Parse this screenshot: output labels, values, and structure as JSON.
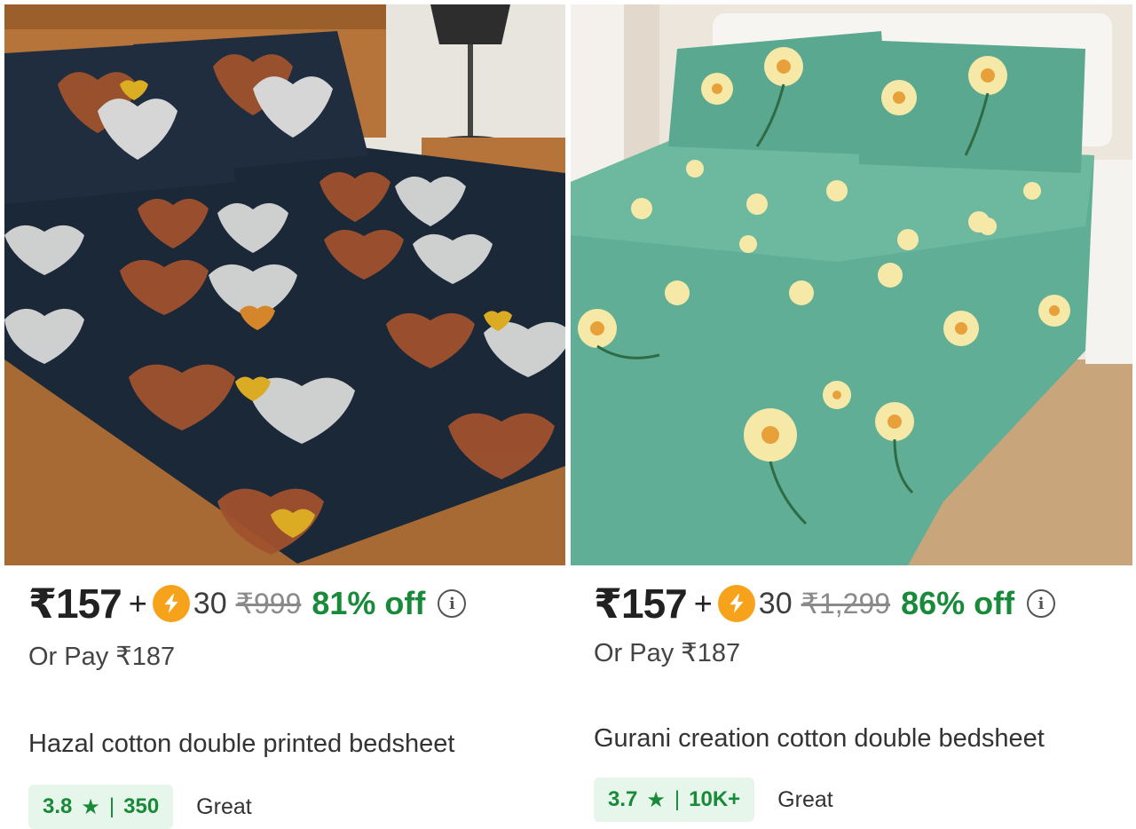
{
  "products": [
    {
      "image_alt": "Dark navy bedsheet with heart print",
      "price": "₹157",
      "plus": "+",
      "coin_icon": "lightning-coin-icon",
      "coins": "30",
      "mrp": "₹999",
      "discount": "81% off",
      "or_pay": "Or Pay ₹187",
      "title": "Hazal cotton double printed bedsheet",
      "rating": "3.8",
      "rating_sep": "|",
      "reviews": "350",
      "rating_label": "Great"
    },
    {
      "image_alt": "Mint green bedsheet with yellow flower print",
      "price": "₹157",
      "plus": "+",
      "coin_icon": "lightning-coin-icon",
      "coins": "30",
      "mrp": "₹1,299",
      "discount": "86% off",
      "or_pay": "Or Pay ₹187",
      "title": "Gurani creation cotton double bedsheet",
      "rating": "3.7",
      "rating_sep": "|",
      "reviews": "10K+",
      "rating_label": "Great"
    }
  ],
  "colors": {
    "discount_green": "#188a3a",
    "rating_bg": "#e7f6ea",
    "coin_orange": "#f7a21b"
  }
}
